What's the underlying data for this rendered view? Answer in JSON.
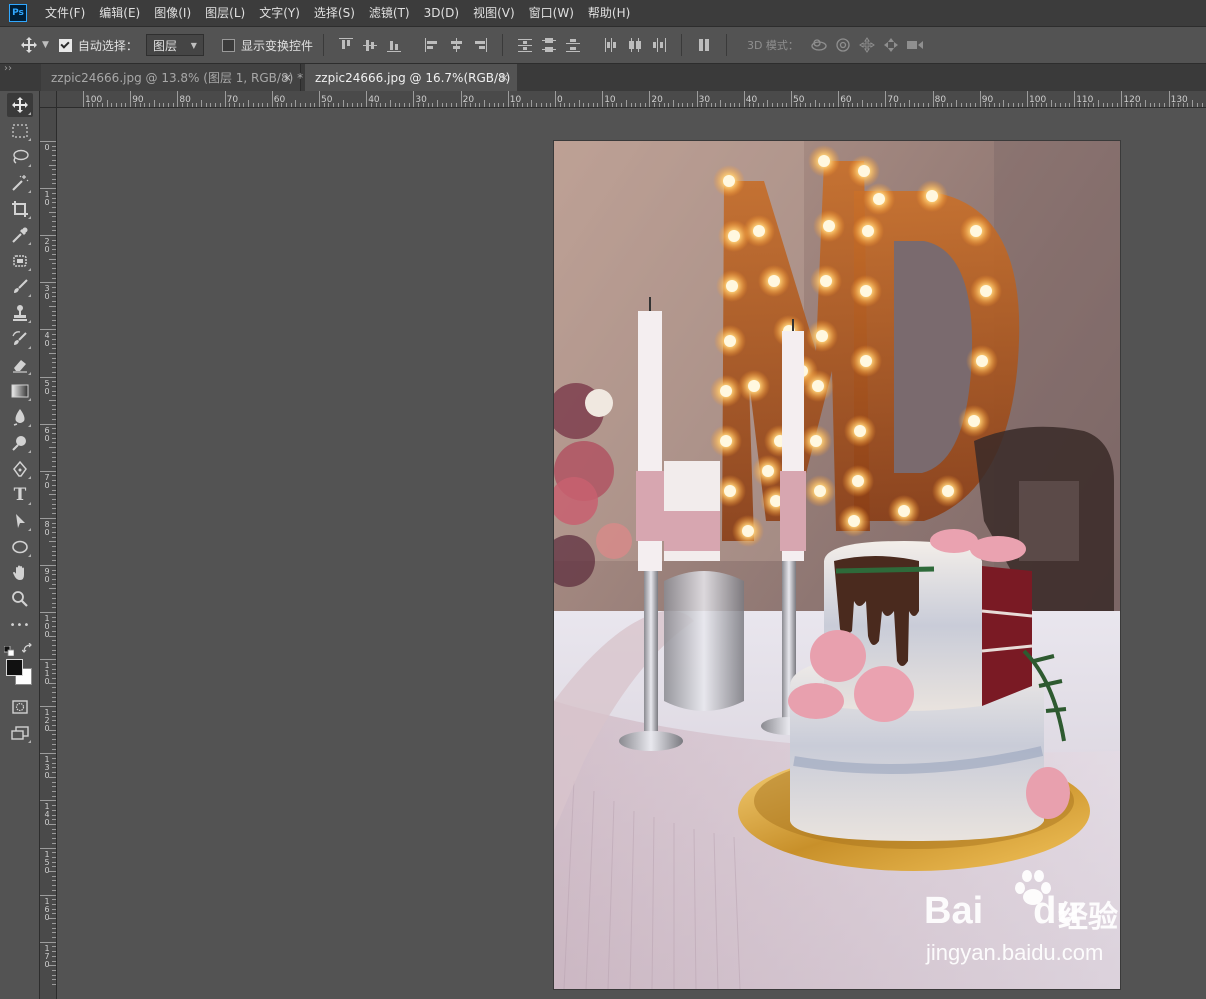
{
  "app": {
    "logo_text": "Ps"
  },
  "menu": [
    "文件(F)",
    "编辑(E)",
    "图像(I)",
    "图层(L)",
    "文字(Y)",
    "选择(S)",
    "滤镜(T)",
    "3D(D)",
    "视图(V)",
    "窗口(W)",
    "帮助(H)"
  ],
  "options": {
    "auto_select_label": "自动选择：",
    "auto_select_checked": true,
    "auto_select_target": "图层",
    "show_transform_label": "显示变换控件",
    "show_transform_checked": false,
    "mode_3d_label": "3D 模式："
  },
  "tabs": [
    {
      "label": "zzpic24666.jpg @ 13.8% (图层 1, RGB/8) *",
      "close": "×",
      "active": false
    },
    {
      "label": "zzpic24666.jpg @ 16.7%(RGB/8)",
      "close": "×",
      "active": true
    }
  ],
  "ruler": {
    "horizontal_labels": [
      "100",
      "90",
      "80",
      "70",
      "60",
      "50",
      "40",
      "30",
      "20",
      "10",
      "0",
      "10",
      "20",
      "30",
      "40",
      "50",
      "60",
      "70",
      "80",
      "90",
      "100",
      "110",
      "120",
      "130"
    ],
    "vertical_labels": [
      "0",
      "10",
      "20",
      "30",
      "40",
      "50",
      "60",
      "70",
      "80",
      "90",
      "100",
      "110",
      "120",
      "130",
      "140",
      "150",
      "160",
      "170"
    ]
  },
  "tools": [
    "move-tool",
    "marquee-tool",
    "lasso-tool",
    "magic-wand-tool",
    "crop-tool",
    "eyedropper-tool",
    "healing-brush-tool",
    "brush-tool",
    "clone-stamp-tool",
    "history-brush-tool",
    "eraser-tool",
    "gradient-tool",
    "blur-tool",
    "dodge-tool",
    "pen-tool",
    "type-tool",
    "path-selection-tool",
    "ellipse-tool",
    "hand-tool",
    "zoom-tool",
    "more-tools"
  ],
  "type_tool_glyph": "T",
  "more_tools_glyph": "•••",
  "watermark": {
    "logo": "Bai",
    "logo_tail": "du",
    "chinese": "经验",
    "url": "jingyan.baidu.com"
  }
}
